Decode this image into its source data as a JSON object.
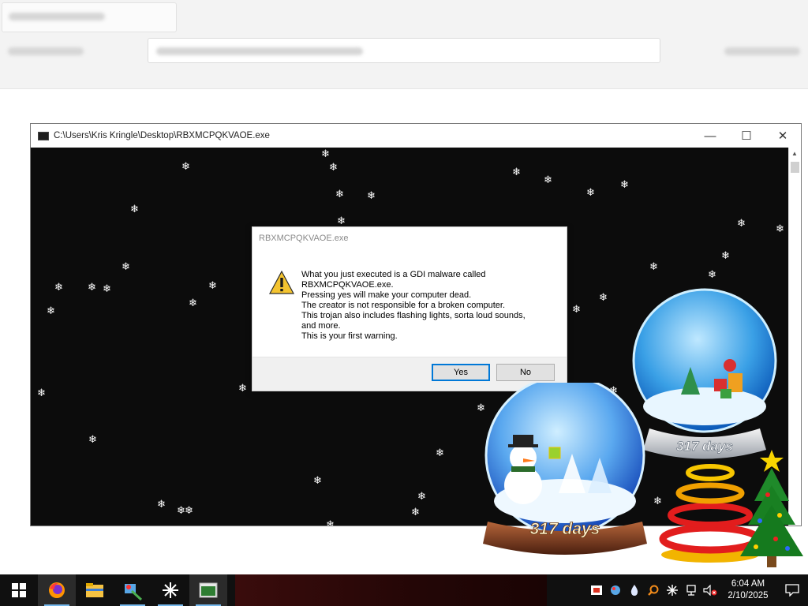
{
  "console": {
    "title": "C:\\Users\\Kris Kringle\\Desktop\\RBXMCPQKVAOE.exe",
    "minimize": "—",
    "maximize": "☐",
    "close": "✕"
  },
  "dialog": {
    "title": "RBXMCPQKVAOE.exe",
    "message": "What you just executed is a GDI malware called\nRBXMCPQKVAOE.exe.\nPressing yes will make your computer dead.\nThe creator is not responsible for a broken computer.\nThis trojan also includes flashing lights, sorta loud sounds,\nand more.\nThis is your first warning.",
    "yes_label": "Yes",
    "no_label": "No",
    "icon": "warning-icon"
  },
  "snowglobes": {
    "front_label": "317 days",
    "back_label": "317 days"
  },
  "snowflake_glyph": "❄",
  "taskbar": {
    "apps": [
      "start",
      "firefox",
      "file-explorer",
      "paint",
      "snowflake-app",
      "console-window"
    ],
    "clock_time": "6:04 AM",
    "clock_date": "2/10/2025"
  },
  "colors": {
    "console_bg": "#0c0c0c",
    "taskbar_bg": "#101010",
    "dialog_footer": "#f0f0f0",
    "accent": "#0078d7"
  }
}
